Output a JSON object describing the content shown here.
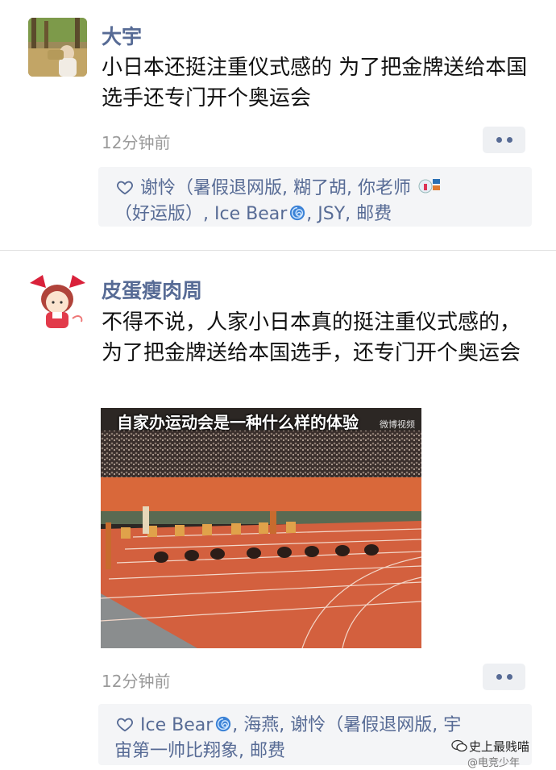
{
  "posts": [
    {
      "author": "大宇",
      "text": "小日本还挺注重仪式感的 为了把金牌送给本国选手还专门开个奥运会",
      "time": "12分钟前",
      "likes": {
        "line1": "谢怜（暑假退网版, 糊了胡, 你老师",
        "line2_a": "（好运版）, Ice Bear",
        "line2_b": ", JSY, 邮费"
      }
    },
    {
      "author": "皮蛋瘦肉周",
      "text": "不得不说，人家小日本真的挺注重仪式感的，为了把金牌送给本国选手，还专门开个奥运会",
      "time": "12分钟前",
      "video": {
        "caption": "自家办运动会是一种什么样的体验",
        "badge": "微博视频"
      },
      "likes": {
        "line1_a": "Ice Bear",
        "line1_b": ", 海燕, 谢怜（暑假退网版, 宇",
        "line2": "宙第一帅比翔象, 邮费"
      }
    }
  ],
  "watermark": {
    "line1": "史上最贱喵",
    "line2": "@电竞少年"
  },
  "icons": {
    "like": "heart-outline-icon",
    "more": "more-dots-icon",
    "swirl": "cyclone-emoji-icon"
  },
  "colors": {
    "link": "#576b95",
    "time": "#9a9a9a",
    "like_bg": "#f4f5f7"
  }
}
